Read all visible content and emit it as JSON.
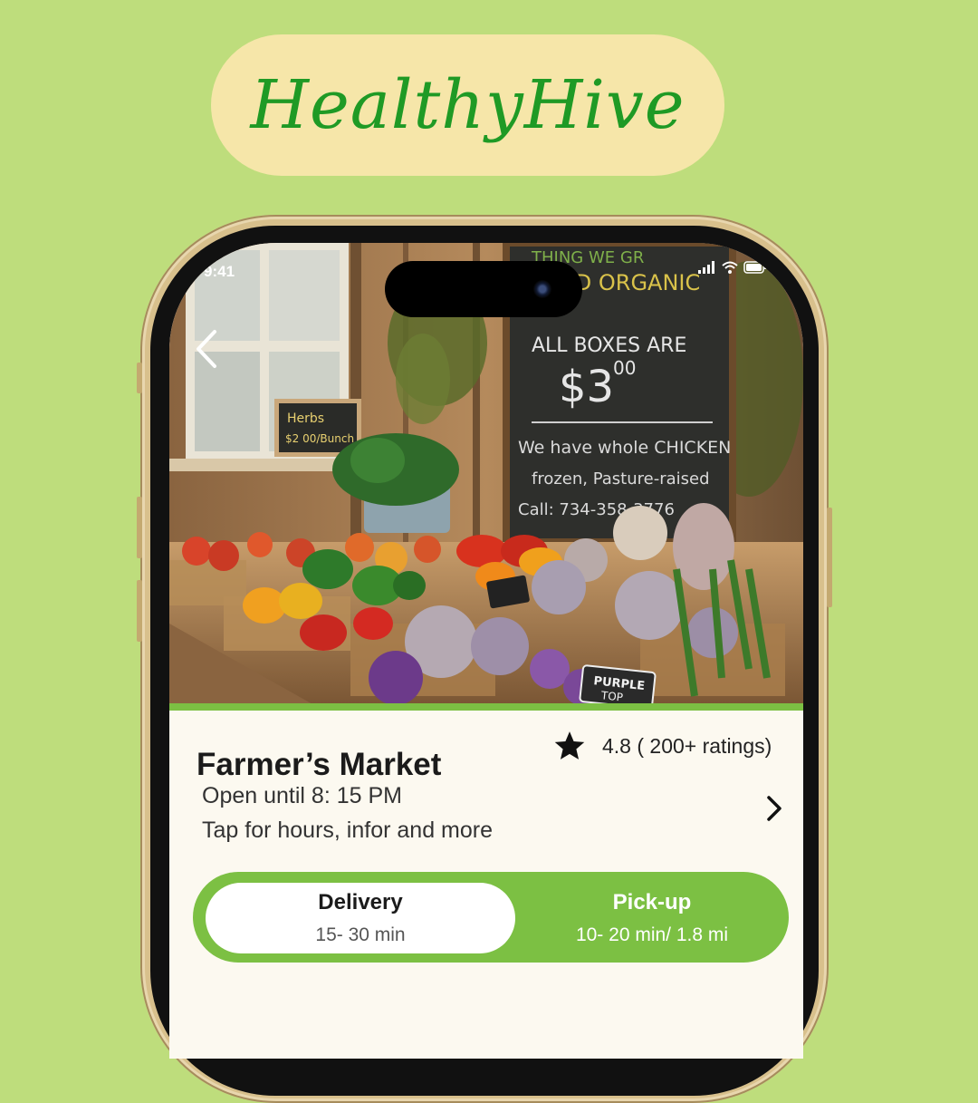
{
  "brand": {
    "name": "HealthyHive"
  },
  "status_bar": {
    "time": "9:41"
  },
  "hero": {
    "chalkboard_lines": [
      "THING WE GR",
      "TIFIED ORGANIC",
      "ALL BOXES ARE",
      "$3",
      "00",
      "We have whole CHICKEN",
      "frozen, Pasture-raised",
      "Call: 734-358-3776"
    ],
    "herbs_sign": [
      "Herbs",
      "$2 00/Bunch"
    ],
    "tag_purple_top": [
      "PURPLE",
      "TOP"
    ]
  },
  "store": {
    "name": "Farmer’s Market",
    "rating": "4.8 ( 200+ ratings)",
    "hours": "Open until 8: 15 PM",
    "more_info": "Tap for hours, infor and more"
  },
  "fulfillment": {
    "selected": "delivery",
    "delivery": {
      "label": "Delivery",
      "time": "15- 30 min"
    },
    "pickup": {
      "label": "Pick-up",
      "time": "10- 20 min/ 1.8 mi"
    }
  },
  "colors": {
    "background": "#bedd7c",
    "brand_pill": "#f6e6a9",
    "brand_text": "#1f9a25",
    "accent": "#7cc043",
    "phone_frame": "#d8c08c"
  },
  "icons": {
    "back": "chevron-left-icon",
    "rating": "star-icon",
    "details": "chevron-right-icon",
    "signal": "signal-icon",
    "wifi": "wifi-icon",
    "battery": "battery-icon"
  }
}
